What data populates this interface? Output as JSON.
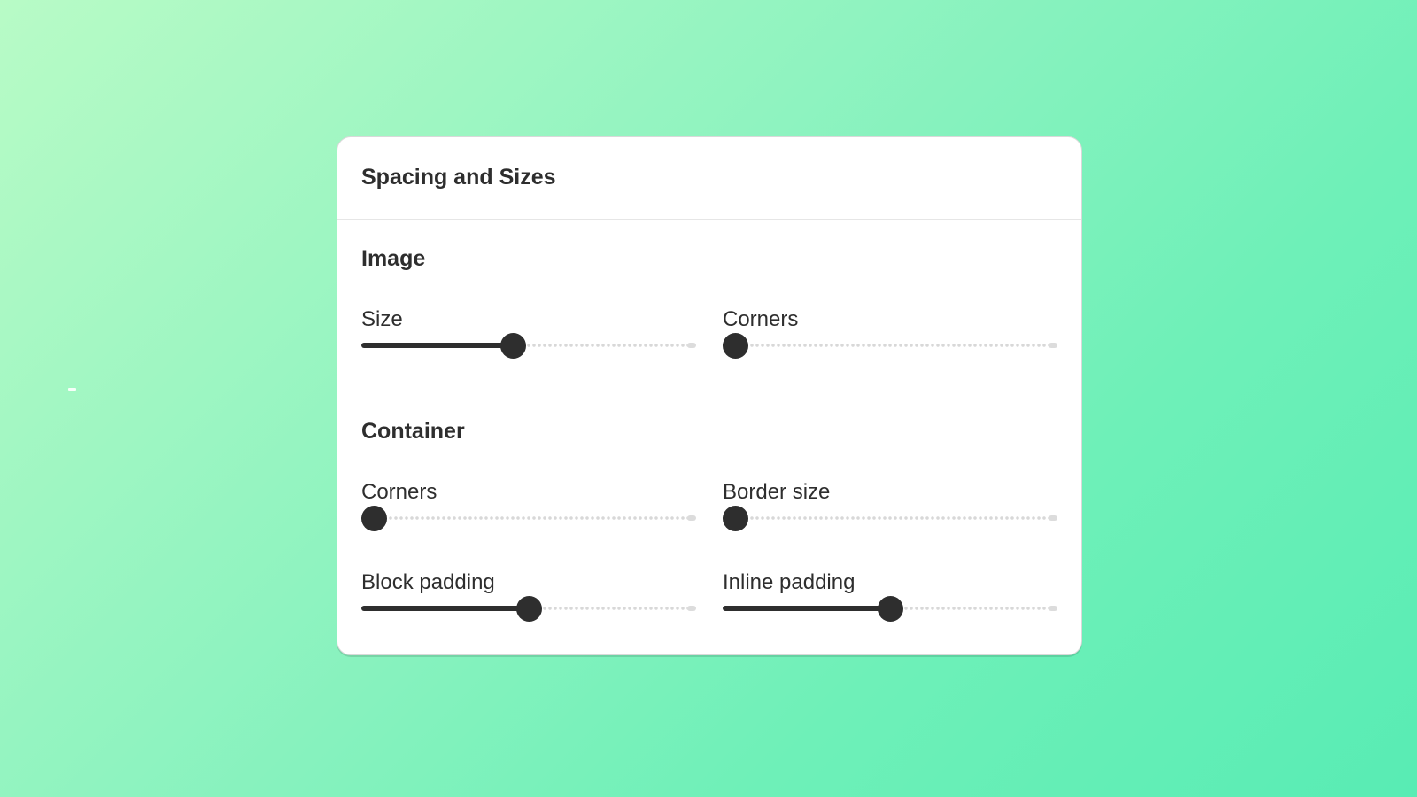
{
  "panel": {
    "title": "Spacing and Sizes"
  },
  "sections": {
    "image": {
      "title": "Image",
      "size": {
        "label": "Size",
        "value": 0.455
      },
      "corners": {
        "label": "Corners",
        "value": 0.038
      }
    },
    "container": {
      "title": "Container",
      "corners": {
        "label": "Corners",
        "value": 0.038
      },
      "border_size": {
        "label": "Border size",
        "value": 0.038
      },
      "block_padding": {
        "label": "Block padding",
        "value": 0.5
      },
      "inline_padding": {
        "label": "Inline padding",
        "value": 0.5
      }
    }
  },
  "colors": {
    "slider_active": "#2e2e2e",
    "slider_inactive": "#d8d8d8",
    "card_background": "#ffffff"
  }
}
